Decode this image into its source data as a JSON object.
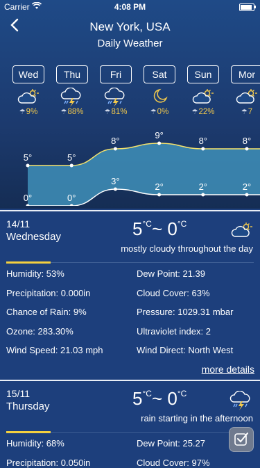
{
  "status": {
    "carrier": "Carrier",
    "time": "4:08 PM"
  },
  "header": {
    "title": "New York, USA",
    "subtitle": "Daily Weather"
  },
  "days": [
    {
      "label": "Wed",
      "icon": "partly-cloudy-icon",
      "rain": "9%"
    },
    {
      "label": "Thu",
      "icon": "thunderstorm-icon",
      "rain": "88%"
    },
    {
      "label": "Fri",
      "icon": "thunderstorm-icon",
      "rain": "81%"
    },
    {
      "label": "Sat",
      "icon": "moon-icon",
      "rain": "0%"
    },
    {
      "label": "Sun",
      "icon": "partly-cloudy-icon",
      "rain": "22%"
    },
    {
      "label": "Mor",
      "icon": "partly-cloudy-icon",
      "rain": "7"
    }
  ],
  "chart_data": {
    "type": "area",
    "x": [
      "Wed",
      "Thu",
      "Fri",
      "Sat",
      "Sun",
      "Mon"
    ],
    "series": [
      {
        "values": [
          5,
          5,
          8,
          9,
          8,
          8
        ],
        "labels": [
          "5°",
          "5°",
          "8°",
          "9°",
          "8°",
          "8°"
        ]
      },
      {
        "values": [
          0,
          0,
          3,
          2,
          2,
          2
        ],
        "labels": [
          "0°",
          "0°",
          "3°",
          "2°",
          "2°",
          "2°"
        ]
      }
    ],
    "colors": {
      "high_line": "#f7e36b",
      "low_line": "#ffffff",
      "fill": "#3f8fb8"
    }
  },
  "cards": [
    {
      "date": "14/11",
      "weekday": "Wednesday",
      "temp_high": "5",
      "temp_low": "0",
      "unit": "C",
      "tilde": "~",
      "icon": "partly-cloudy-icon",
      "condition": "mostly cloudy throughout the day",
      "details": [
        "Humidity: 53%",
        "Dew Point: 21.39",
        "Precipitation: 0.000in",
        "Cloud Cover: 63%",
        "Chance of Rain: 9%",
        "Pressure: 1029.31 mbar",
        "Ozone: 283.30%",
        "Ultraviolet index: 2",
        "Wind Speed: 21.03 mph",
        "Wind Direct: North West"
      ],
      "more": "more details"
    },
    {
      "date": "15/11",
      "weekday": "Thursday",
      "temp_high": "5",
      "temp_low": "0",
      "unit": "C",
      "tilde": "~",
      "icon": "thunderstorm-icon",
      "condition": "rain starting in the afternoon",
      "details": [
        "Humidity: 68%",
        "Dew Point: 25.27",
        "Precipitation: 0.050in",
        "Cloud Cover: 97%"
      ]
    }
  ],
  "colors": {
    "accent": "#f4d03f",
    "background": "#1d3f7c"
  }
}
